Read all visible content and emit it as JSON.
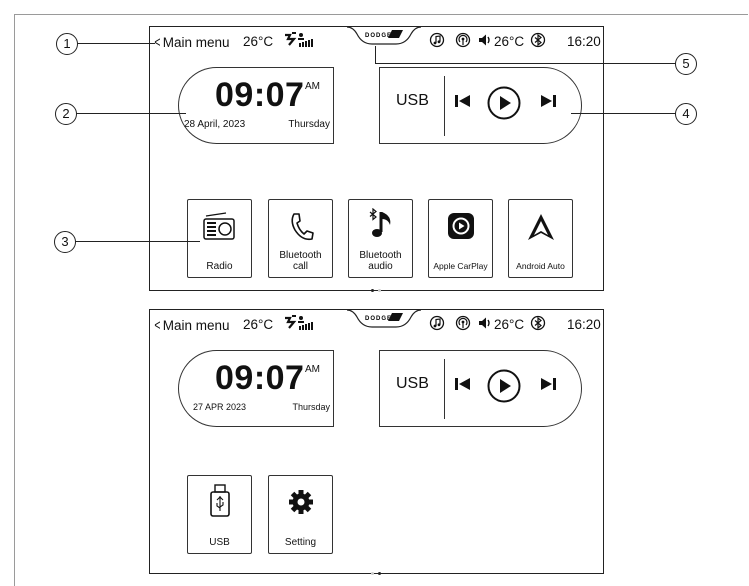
{
  "callouts": [
    "1",
    "2",
    "3",
    "4",
    "5"
  ],
  "screens": [
    {
      "status": {
        "menu_label": "Main menu",
        "outside_temp": "26°C",
        "brand": "DODGE",
        "inside_temp": "26°C",
        "time": "16:20"
      },
      "clock": {
        "time": "09:07",
        "ampm": "AM",
        "date": "28 April, 2023",
        "day": "Thursday"
      },
      "media": {
        "source": "USB"
      },
      "apps": [
        {
          "label": "Radio",
          "icon": "radio-icon"
        },
        {
          "label": "Bluetooth call",
          "icon": "phone-icon"
        },
        {
          "label": "Bluetooth audio",
          "icon": "bluetooth-music-icon"
        },
        {
          "label": "Apple CarPlay",
          "icon": "carplay-icon"
        },
        {
          "label": "Android Auto",
          "icon": "android-auto-icon"
        }
      ],
      "page_indicator": {
        "current": 1,
        "total": 2
      }
    },
    {
      "status": {
        "menu_label": "Main menu",
        "outside_temp": "26°C",
        "brand": "DODGE",
        "inside_temp": "26°C",
        "time": "16:20"
      },
      "clock": {
        "time": "09:07",
        "ampm": "AM",
        "date": "27 APR 2023",
        "day": "Thursday"
      },
      "media": {
        "source": "USB"
      },
      "apps": [
        {
          "label": "USB",
          "icon": "usb-icon"
        },
        {
          "label": "Setting",
          "icon": "gear-icon"
        }
      ],
      "page_indicator": {
        "current": 2,
        "total": 2
      }
    }
  ]
}
